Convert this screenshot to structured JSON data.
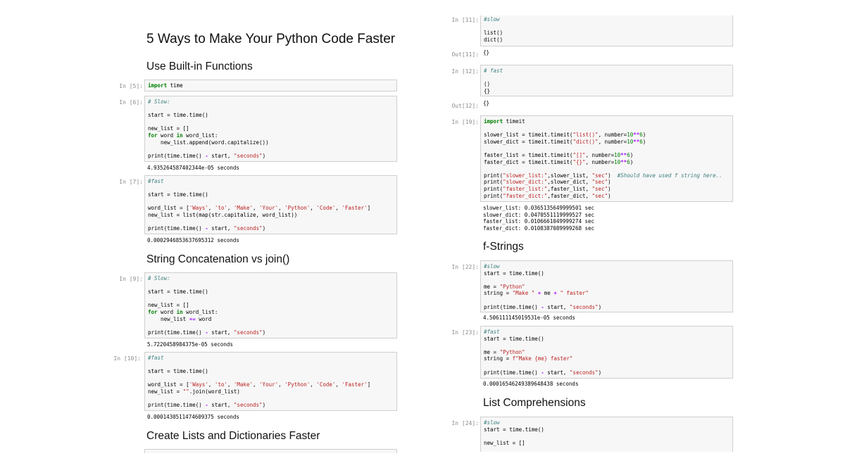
{
  "title": "5 Ways to Make Your Python Code Faster",
  "headings": {
    "builtin": "Use Built-in Functions",
    "concat": "String Concatenation vs join()",
    "lists_dicts": "Create Lists and Dictionaries Faster",
    "fstrings": "f-Strings",
    "comprehensions": "List Comprehensions"
  },
  "prompts": {
    "p5": "In [5]:",
    "p6": "In [6]:",
    "p7": "In [7]:",
    "p9": "In [9]:",
    "p10": "In [10]:",
    "p11": "In [11]:",
    "out11": "Out[11]:",
    "p12": "In [12]:",
    "out12": "Out[12]:",
    "p19": "In [19]:",
    "p22": "In [22]:",
    "p23": "In [23]:",
    "p24": "In [24]:"
  },
  "cells": {
    "c5": [
      "import time"
    ],
    "c6": [
      "# Slow:",
      "",
      "start = time.time()",
      "",
      "new_list = []",
      "for word in word_list:",
      "    new_list.append(word.capitalize())",
      "",
      "print(time.time() - start, \"seconds\")"
    ],
    "c7": [
      "#fast",
      "",
      "start = time.time()",
      "",
      "word_list = ['Ways', 'to', 'Make', 'Your', 'Python', 'Code', 'Faster']",
      "new_list = list(map(str.capitalize, word_list))",
      "",
      "print(time.time() - start, \"seconds\")"
    ],
    "c9": [
      "# Slow:",
      "",
      "start = time.time()",
      "",
      "new_list = []",
      "for word in word_list:",
      "    new_list += word",
      "",
      "print(time.time() - start, \"seconds\")"
    ],
    "c10": [
      "#fast",
      "",
      "start = time.time()",
      "",
      "word_list = ['Ways', 'to', 'Make', 'Your', 'Python', 'Code', 'Faster']",
      "new_list = \"\".join(word_list)",
      "",
      "print(time.time() - start, \"seconds\")"
    ],
    "c11": [
      "#slow",
      "",
      "list()",
      "dict()"
    ],
    "c12": [
      "# fast",
      "",
      "()",
      "{}"
    ],
    "c19": [
      "import timeit",
      "",
      "slower_list = timeit.timeit(\"list()\", number=10**6)",
      "slower_dict = timeit.timeit(\"dict()\", number=10**6)",
      "",
      "faster_list = timeit.timeit(\"[]\", number=10**6)",
      "faster_dict = timeit.timeit(\"{}\", number=10**6)",
      "",
      "print(\"slower_list:\",slower_list, \"sec\")  #Should have used f string here..",
      "print(\"slower_dict:\",slower_dict, \"sec\")",
      "print(\"faster_list:\",faster_list, \"sec\")",
      "print(\"faster_dict:\",faster_dict, \"sec\")"
    ],
    "c22": [
      "#slow",
      "start = time.time()",
      "",
      "me = \"Python\"",
      "string = \"Make \" + me + \" faster\"",
      "",
      "print(time.time() - start, \"seconds\")"
    ],
    "c23": [
      "#fast",
      "start = time.time()",
      "",
      "me = \"Python\"",
      "string = f\"Make {me} faster\"",
      "",
      "print(time.time() - start, \"seconds\")"
    ],
    "c24": [
      "#slow",
      "start = time.time()",
      "",
      "new_list = []"
    ]
  },
  "outputs": {
    "o6": "4.935264587402344e-05 seconds",
    "o7": "0.0002946853637695312 seconds",
    "o9": "5.7220458984375e-05 seconds",
    "o10": "0.0001430511474609375 seconds",
    "o11": "{}",
    "o12": "{}",
    "o19": "slower_list: 0.0365135649999501 sec\nslower_dict: 0.0470551119999527 sec\nfaster_list: 0.0106661049999274 sec\nfaster_dict: 0.0108387089999268 sec",
    "o22": "4.506111145019531e-05 seconds",
    "o23": "0.00016546249389648438 seconds"
  },
  "colors": {
    "keyword": "#008000",
    "operator": "#aa22ff",
    "string": "#ba2121",
    "comment": "#408080",
    "cell_background": "#f7f7f7",
    "cell_border": "#cfcfcf",
    "prompt": "#8a8a8a"
  }
}
